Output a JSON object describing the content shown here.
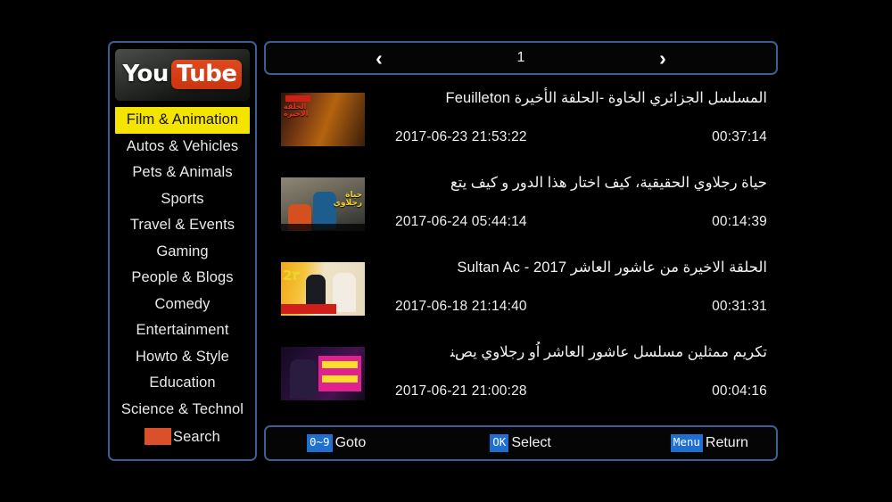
{
  "app": {
    "background_color": "#000000",
    "panel_border_color": "#3c5e92",
    "highlight_color": "#f5e400",
    "accent_red": "#d9502a",
    "key_badge_color": "#1f6fd0"
  },
  "sidebar": {
    "logo": {
      "part_one": "You",
      "part_two": "Tube",
      "brand_color": "#cf3a16"
    },
    "items": [
      {
        "label": "Film & Animation",
        "selected": true
      },
      {
        "label": "Autos & Vehicles",
        "selected": false
      },
      {
        "label": "Pets & Animals",
        "selected": false
      },
      {
        "label": "Sports",
        "selected": false
      },
      {
        "label": "Travel & Events",
        "selected": false
      },
      {
        "label": "Gaming",
        "selected": false
      },
      {
        "label": "People & Blogs",
        "selected": false
      },
      {
        "label": "Comedy",
        "selected": false
      },
      {
        "label": "Entertainment",
        "selected": false
      },
      {
        "label": "Howto & Style",
        "selected": false
      },
      {
        "label": "Education",
        "selected": false
      },
      {
        "label": "Science & Technol",
        "selected": false
      }
    ],
    "search": {
      "label": "Search",
      "swatch_color": "#d9502a"
    }
  },
  "pager": {
    "prev_icon": "chevron-left",
    "prev_glyph": "‹",
    "next_icon": "chevron-right",
    "next_glyph": "›",
    "page_number": "1"
  },
  "videos": [
    {
      "title": "المسلسل الجزائري الخاوة  -الحلقة الأخيرة Feuilleton",
      "date": "2017-06-23 21:53:22",
      "duration": "00:37:14",
      "thumb_overlay": "الحلقة\nالاخيرة"
    },
    {
      "title": "حياة رجلاوي الحقيقية، كيف اختار هذا الدور و كيف يتع",
      "date": "2017-06-24 05:44:14",
      "duration": "00:14:39",
      "thumb_overlay": "حياة\nرجلاوي"
    },
    {
      "title": "الحلقة الاخيرة من عاشور العاشر  Sultan Ac  -  2017",
      "date": "2017-06-18 21:14:40",
      "duration": "00:31:31",
      "thumb_overlay": "2٣"
    },
    {
      "title": "تكريم ممثلين مسلسل عاشور العاشر اُو رجلاوي يصﻨ",
      "date": "2017-06-21 21:00:28",
      "duration": "00:04:16",
      "thumb_overlay": ""
    }
  ],
  "actionbar": [
    {
      "key": "0~9",
      "label": "Goto"
    },
    {
      "key": "OK",
      "label": "Select"
    },
    {
      "key": "Menu",
      "label": "Return"
    }
  ]
}
